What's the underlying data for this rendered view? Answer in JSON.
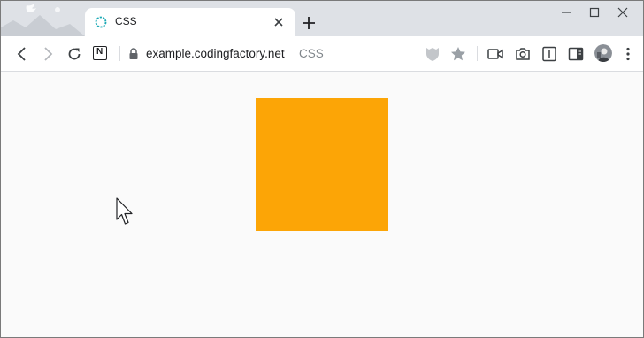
{
  "tab": {
    "title": "CSS"
  },
  "address_bar": {
    "host": "example.codingfactory.net",
    "page_title_suffix": "CSS"
  },
  "extensions": {
    "notion_letter": "N"
  },
  "icons": {
    "favicon": "loading-spinner-icon",
    "close": "close-icon",
    "new_tab": "plus-icon",
    "back": "arrow-left-icon",
    "forward": "arrow-right-icon",
    "reload": "reload-icon",
    "lock": "lock-icon",
    "shield": "shield-extension-icon",
    "star": "star-icon",
    "video": "video-camera-icon",
    "camera": "camera-icon",
    "reader": "reader-mode-icon",
    "sidepanel": "side-panel-icon",
    "menu": "more-vertical-icon",
    "cursor": "mouse-pointer-icon"
  },
  "colors": {
    "box": "#fca506",
    "spinner": "#1ba9b5",
    "titlebar": "#dee1e6",
    "page_background": "#fafafa"
  }
}
